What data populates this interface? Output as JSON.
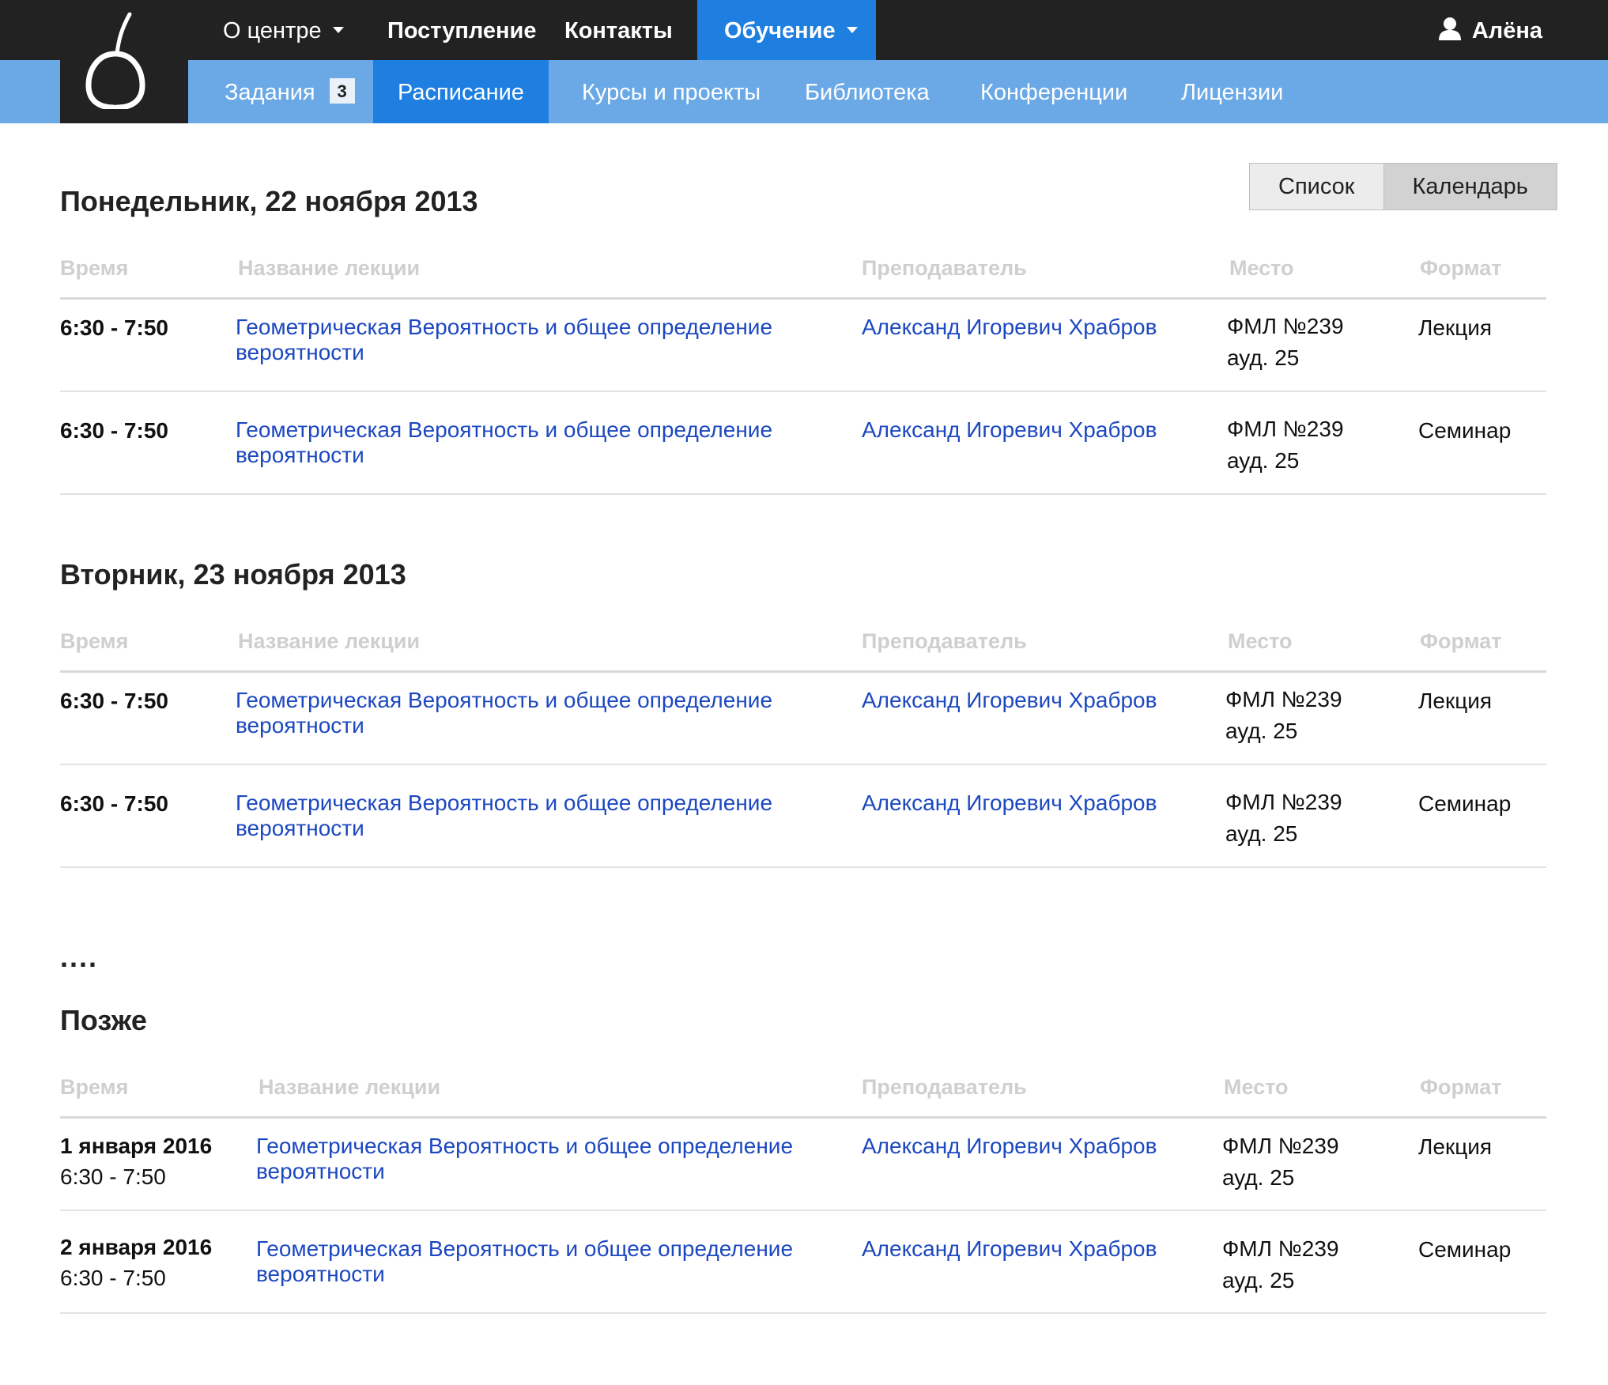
{
  "nav": {
    "top": [
      {
        "label": "О центре",
        "dropdown": true
      },
      {
        "label": "Поступление"
      },
      {
        "label": "Контакты"
      },
      {
        "label": "Обучение",
        "dropdown": true,
        "active": true
      }
    ],
    "user": "Алёна",
    "sub": [
      {
        "label": "Задания",
        "badge": "3"
      },
      {
        "label": "Расписание",
        "active": true
      },
      {
        "label": "Курсы и проекты"
      },
      {
        "label": "Библиотека"
      },
      {
        "label": "Конференции"
      },
      {
        "label": "Лицензии"
      }
    ]
  },
  "view_toggle": {
    "list": "Список",
    "calendar": "Календарь",
    "selected": "calendar"
  },
  "columns": {
    "time": "Время",
    "title": "Название лекции",
    "teacher": "Преподаватель",
    "place": "Место",
    "format": "Формат"
  },
  "sections": [
    {
      "heading": "Понедельник, 22 ноября 2013",
      "rows": [
        {
          "time": "6:30 - 7:50",
          "title_1": "Геометрическая Вероятность и общее определение",
          "title_2": "вероятности",
          "teacher": "Александ Игоревич Храбров",
          "place_1": "ФМЛ №239",
          "place_2": "ауд. 25",
          "format": "Лекция"
        },
        {
          "time": "6:30 - 7:50",
          "title_1": "Геометрическая Вероятность и общее  определение",
          "title_2": "вероятности",
          "teacher": "Александ Игоревич Храбров",
          "place_1": "ФМЛ №239",
          "place_2": "ауд. 25",
          "format": "Семинар"
        }
      ]
    },
    {
      "heading": "Вторник, 23 ноября 2013",
      "rows": [
        {
          "time": "6:30 - 7:50",
          "title_1": "Геометрическая Вероятность и общее определение",
          "title_2": "вероятности",
          "teacher": "Александ Игоревич Храбров",
          "place_1": "ФМЛ №239",
          "place_2": "ауд. 25",
          "format": "Лекция"
        },
        {
          "time": "6:30 - 7:50",
          "title_1": "Геометрическая Вероятность и общее  определение",
          "title_2": "вероятности",
          "teacher": "Александ Игоревич Храбров",
          "place_1": "ФМЛ №239",
          "place_2": "ауд. 25",
          "format": "Семинар"
        }
      ]
    },
    {
      "heading": "Позже",
      "rows": [
        {
          "date": "1 января 2016",
          "time": "6:30 - 7:50",
          "title_1": "Геометрическая Вероятность и общее определение",
          "title_2": "вероятности",
          "teacher": "Александ Игоревич Храбров",
          "place_1": "ФМЛ №239",
          "place_2": "ауд. 25",
          "format": "Лекция"
        },
        {
          "date": "2 января 2016",
          "time": "6:30 - 7:50",
          "title_1": "Геометрическая Вероятность и общее  определение",
          "title_2": "вероятности",
          "teacher": "Александ Игоревич Храбров",
          "place_1": "ФМЛ №239",
          "place_2": "ауд. 25",
          "format": "Семинар"
        }
      ]
    }
  ],
  "ellipsis": "....",
  "colors": {
    "topbar": "#222222",
    "subbar": "#6aa8e6",
    "active": "#1e7fe1",
    "link": "#1c48c0",
    "column_header": "#cfcfcf"
  }
}
